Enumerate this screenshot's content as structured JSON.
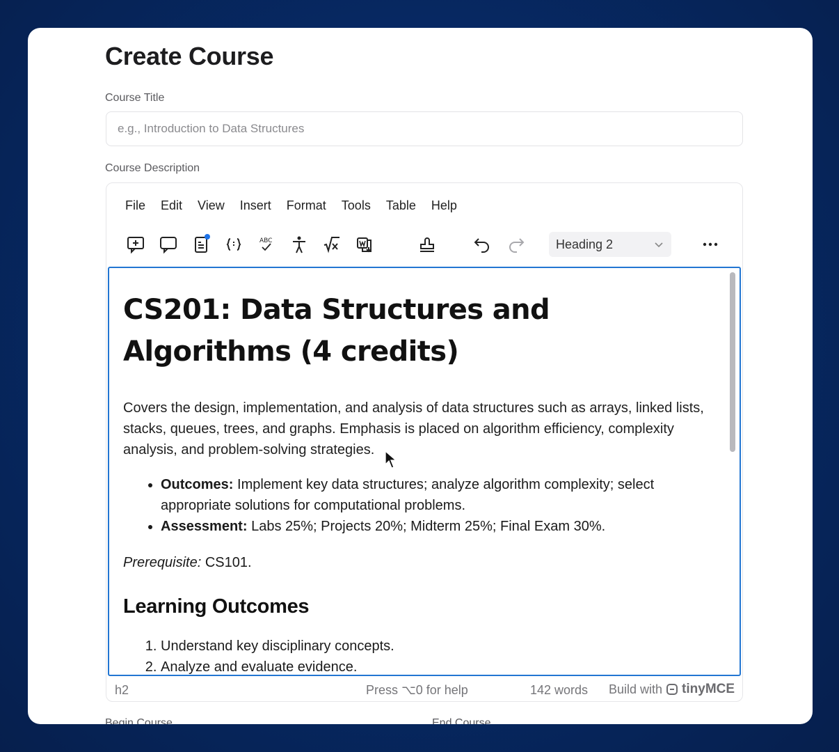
{
  "page": {
    "title": "Create Course"
  },
  "course_title": {
    "label": "Course Title",
    "placeholder": "e.g., Introduction to Data Structures",
    "value": ""
  },
  "course_description": {
    "label": "Course Description"
  },
  "editor": {
    "menu": [
      "File",
      "Edit",
      "View",
      "Insert",
      "Format",
      "Tools",
      "Table",
      "Help"
    ],
    "toolbar_icons": [
      "add-comment-icon",
      "comments-icon",
      "revision-history-icon",
      "merge-tags-icon",
      "spellcheck-icon",
      "accessibility-icon",
      "math-equation-icon",
      "import-word-icon",
      "stamp-icon",
      "undo-icon",
      "redo-icon",
      "more-icon"
    ],
    "block_format": "Heading 2",
    "content": {
      "heading": "CS201: Data Structures and Algorithms (4 credits)",
      "paragraph": "Covers the design, implementation, and analysis of data structures such as arrays, linked lists, stacks, queues, trees, and graphs. Emphasis is placed on algorithm efficiency, complexity analysis, and problem-solving strategies.",
      "bullets": [
        {
          "label": "Outcomes:",
          "text": " Implement key data structures; analyze algorithm complexity; select appropriate solutions for computational problems."
        },
        {
          "label": "Assessment:",
          "text": " Labs 25%; Projects 20%; Midterm 25%; Final Exam 30%."
        }
      ],
      "prerequisite_label": "Prerequisite:",
      "prerequisite_value": " CS101.",
      "subheading": "Learning Outcomes",
      "outcomes": [
        "Understand key disciplinary concepts.",
        "Analyze and evaluate evidence."
      ]
    },
    "status": {
      "path": "h2",
      "help": "Press ⌥0 for help",
      "word_count": "142 words",
      "build_with": "Build with",
      "brand": "tinyMCE"
    }
  },
  "below": {
    "begin_course_label": "Begin Course",
    "end_course_label": "End Course"
  }
}
